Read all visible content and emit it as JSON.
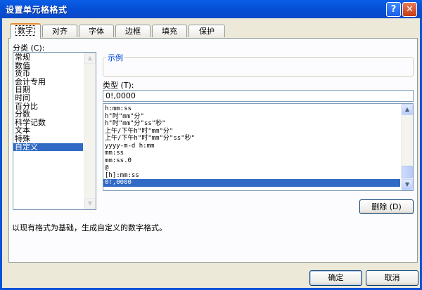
{
  "window": {
    "title": "设置单元格格式",
    "help_label": "?",
    "close_label": "✕"
  },
  "tabs": [
    {
      "label": "数字",
      "active": true
    },
    {
      "label": "对齐"
    },
    {
      "label": "字体"
    },
    {
      "label": "边框"
    },
    {
      "label": "填充"
    },
    {
      "label": "保护"
    }
  ],
  "category": {
    "label": "分类 (C):",
    "items": [
      "常规",
      "数值",
      "货币",
      "会计专用",
      "日期",
      "时间",
      "百分比",
      "分数",
      "科学记数",
      "文本",
      "特殊",
      "自定义"
    ],
    "selected_index": 11
  },
  "sample": {
    "label": "示例",
    "value": ""
  },
  "type": {
    "label": "类型 (T):",
    "value": "0!,0000",
    "items": [
      "h:mm:ss",
      "h\"时\"mm\"分\"",
      "h\"时\"mm\"分\"ss\"秒\"",
      "上午/下午h\"时\"mm\"分\"",
      "上午/下午h\"时\"mm\"分\"ss\"秒\"",
      "yyyy-m-d h:mm",
      "mm:ss",
      "mm:ss.0",
      "@",
      "[h]:mm:ss",
      "0!,0000"
    ],
    "selected_index": 10
  },
  "buttons": {
    "delete": "删除 (D)",
    "ok": "确定",
    "cancel": "取消"
  },
  "description": "以现有格式为基础，生成自定义的数字格式。",
  "colors": {
    "title_bar": "#0650d6",
    "selection": "#316ac5",
    "group_title": "#0046d5",
    "tab_highlight": "#e68b2c"
  },
  "icons": {
    "scroll_up": "▲",
    "scroll_down": "▼"
  }
}
